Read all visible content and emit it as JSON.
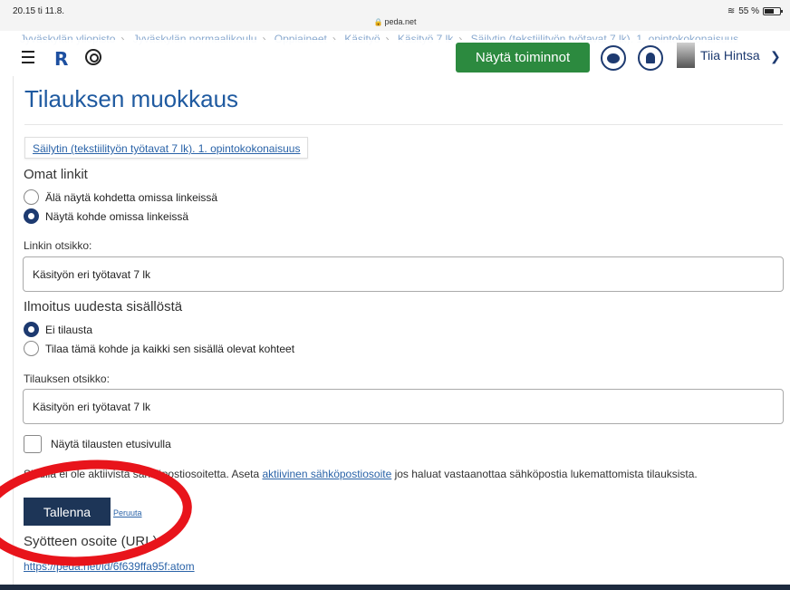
{
  "status_bar": {
    "time": "20.15  ti 11.8.",
    "url": "peda.net",
    "battery": "55 %"
  },
  "breadcrumb": [
    "Jyväskylän yliopisto",
    "Jyväskylän normaalikoulu",
    "Oppiaineet",
    "Käsityö",
    "Käsityö 7 lk",
    "Säilytin (tekstiilityön työtavat 7 lk). 1. opintokokonaisuus"
  ],
  "topnav": {
    "logo": "R",
    "actions_button": "Näytä toiminnot",
    "user_name": "Tiia Hintsa",
    "chevron": "⌄"
  },
  "page": {
    "title": "Tilauksen muokkaus",
    "item_link": "Säilytin (tekstiilityön työtavat 7 lk). 1. opintokokonaisuus",
    "own_links": {
      "heading": "Omat linkit",
      "options": [
        {
          "label": "Älä näytä kohdetta omissa linkeissä",
          "selected": false
        },
        {
          "label": "Näytä kohde omissa linkeissä",
          "selected": true
        }
      ],
      "link_title_label": "Linkin otsikko:",
      "link_title_value": "Käsityön eri työtavat 7 lk"
    },
    "notification": {
      "heading": "Ilmoitus uudesta sisällöstä",
      "options": [
        {
          "label": "Ei tilausta",
          "selected": true
        },
        {
          "label": "Tilaa tämä kohde ja kaikki sen sisällä olevat kohteet",
          "selected": false
        }
      ],
      "subscription_title_label": "Tilauksen otsikko:",
      "subscription_title_value": "Käsityön eri työtavat 7 lk"
    },
    "show_on_front": {
      "label": "Näytä tilausten etusivulla",
      "checked": false
    },
    "notice": {
      "before": "Sinulla ei ole aktiivista sähköpostiosoitetta. Aseta ",
      "link": "aktiivinen sähköpostiosoite",
      "after": " jos haluat vastaanottaa sähköpostia lukemattomista tilauksista."
    },
    "save_label": "Tallenna",
    "cancel_label": "Peruuta",
    "feed_heading": "Syötteen osoite (URL)",
    "feed_url": "https://peda.net/id/6f639ffa95f:atom"
  },
  "colors": {
    "accent_green": "#2c8a3f",
    "brand_blue": "#1d3a70",
    "annotation_red": "#e8141b"
  }
}
